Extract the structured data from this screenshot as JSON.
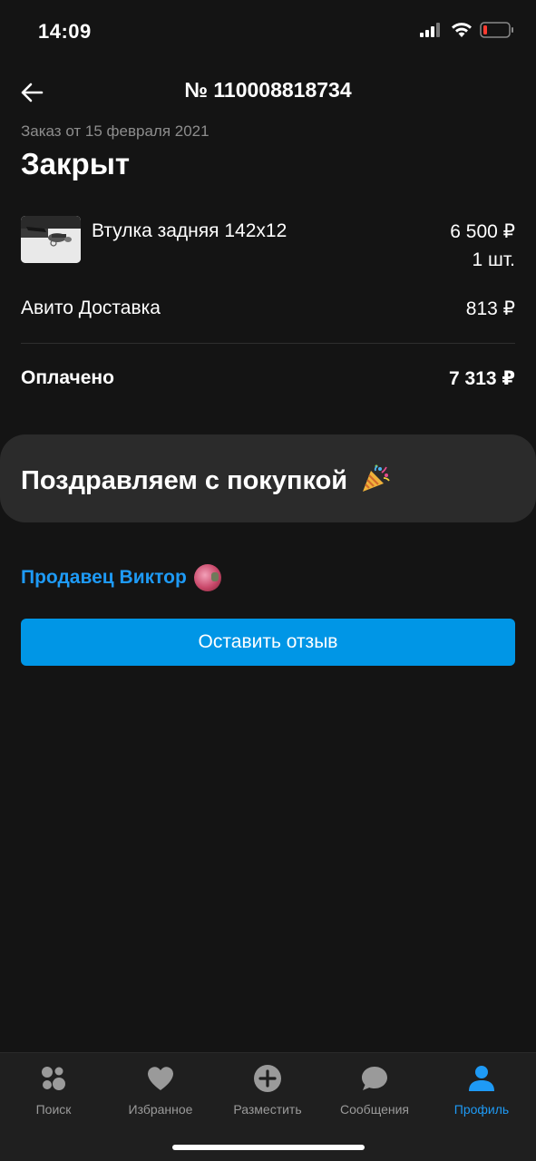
{
  "status_bar": {
    "time": "14:09"
  },
  "header": {
    "title": "№ 110008818734",
    "back_icon": "arrow-left-icon"
  },
  "order": {
    "date": "Заказ от 15 февраля 2021",
    "status": "Закрыт"
  },
  "item": {
    "name": "Втулка задняя 142x12",
    "price": "6 500 ₽",
    "quantity": "1 шт."
  },
  "delivery": {
    "label": "Авито Доставка",
    "price": "813 ₽"
  },
  "payment": {
    "label": "Оплачено",
    "total": "7 313 ₽"
  },
  "congrats": {
    "text": "Поздравляем с покупкой",
    "icon": "party-popper-icon"
  },
  "seller": {
    "label": "Продавец Виктор"
  },
  "review_button": {
    "label": "Оставить отзыв"
  },
  "tabs": [
    {
      "label": "Поиск",
      "icon": "search-dots-icon",
      "active": false
    },
    {
      "label": "Избранное",
      "icon": "heart-icon",
      "active": false
    },
    {
      "label": "Разместить",
      "icon": "plus-circle-icon",
      "active": false
    },
    {
      "label": "Сообщения",
      "icon": "chat-bubble-icon",
      "active": false
    },
    {
      "label": "Профиль",
      "icon": "person-icon",
      "active": true
    }
  ],
  "colors": {
    "background": "#141414",
    "accent": "#1e9af5",
    "button": "#0096e6",
    "card": "#2b2b2b",
    "muted_text": "#8d8d8d",
    "battery_low": "#ff3b30"
  }
}
